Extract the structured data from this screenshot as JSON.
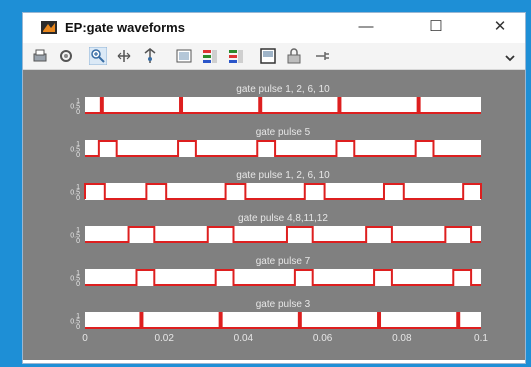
{
  "window": {
    "title": "EP:gate waveforms",
    "minimize_glyph": "—",
    "maximize_glyph": "☐",
    "close_glyph": "✕"
  },
  "toolbar": {
    "icons": [
      "print-icon",
      "link-icon",
      "zoom-in-icon",
      "pan-icon",
      "data-cursor-icon",
      "insert-colorbar-icon",
      "insert-legend-icon",
      "hide-plot-tools-icon",
      "show-plot-tools-icon",
      "dock-icon",
      "lock-icon",
      "pin-icon",
      "more-arrow-icon"
    ]
  },
  "colors": {
    "figure_bg": "#808080",
    "axes_bg": "#ffffff",
    "pulse": "#dd1f1f",
    "text": "#e6e6e6"
  },
  "chart_data": [
    {
      "type": "line",
      "title": "gate pulse 1, 2, 6, 10",
      "xlim": [
        0,
        0.1
      ],
      "ylim": [
        0,
        1
      ],
      "yticks": [
        "1",
        "0.5",
        "0"
      ],
      "pulse_starts": [
        0.004,
        0.024,
        0.044,
        0.064,
        0.084
      ],
      "pulse_width": 0.0005
    },
    {
      "type": "line",
      "title": "gate pulse 5",
      "xlim": [
        0,
        0.1
      ],
      "ylim": [
        0,
        1
      ],
      "yticks": [
        "1",
        "0.5",
        "0"
      ],
      "pulse_starts": [
        0.0035,
        0.0235,
        0.0435,
        0.0635,
        0.0835
      ],
      "pulse_width": 0.0045
    },
    {
      "type": "line",
      "title": "gate pulse 1, 2, 6, 10",
      "xlim": [
        0,
        0.1
      ],
      "ylim": [
        0,
        1
      ],
      "yticks": [
        "1",
        "0.5",
        "0"
      ],
      "pulse_starts": [
        0.0,
        0.0155,
        0.0355,
        0.0555,
        0.0755,
        0.0955
      ],
      "pulse_width": 0.005
    },
    {
      "type": "line",
      "title": "gate pulse 4,8,11,12",
      "xlim": [
        0,
        0.1
      ],
      "ylim": [
        0,
        1
      ],
      "yticks": [
        "1",
        "0.5",
        "0"
      ],
      "pulse_starts": [
        0.011,
        0.031,
        0.051,
        0.071,
        0.091
      ],
      "pulse_width": 0.0065
    },
    {
      "type": "line",
      "title": "gate pulse 7",
      "xlim": [
        0,
        0.1
      ],
      "ylim": [
        0,
        1
      ],
      "yticks": [
        "1",
        "0.5",
        "0"
      ],
      "pulse_starts": [
        0.013,
        0.033,
        0.053,
        0.073,
        0.093
      ],
      "pulse_width": 0.0045
    },
    {
      "type": "line",
      "title": "gate pulse 3",
      "xlim": [
        0,
        0.1
      ],
      "ylim": [
        0,
        1
      ],
      "yticks": [
        "1",
        "0.5",
        "0"
      ],
      "pulse_starts": [
        0.014,
        0.034,
        0.054,
        0.074,
        0.094
      ],
      "pulse_width": 0.0005,
      "xticks": [
        "0",
        "0.02",
        "0.04",
        "0.06",
        "0.08",
        "0.1"
      ]
    }
  ]
}
